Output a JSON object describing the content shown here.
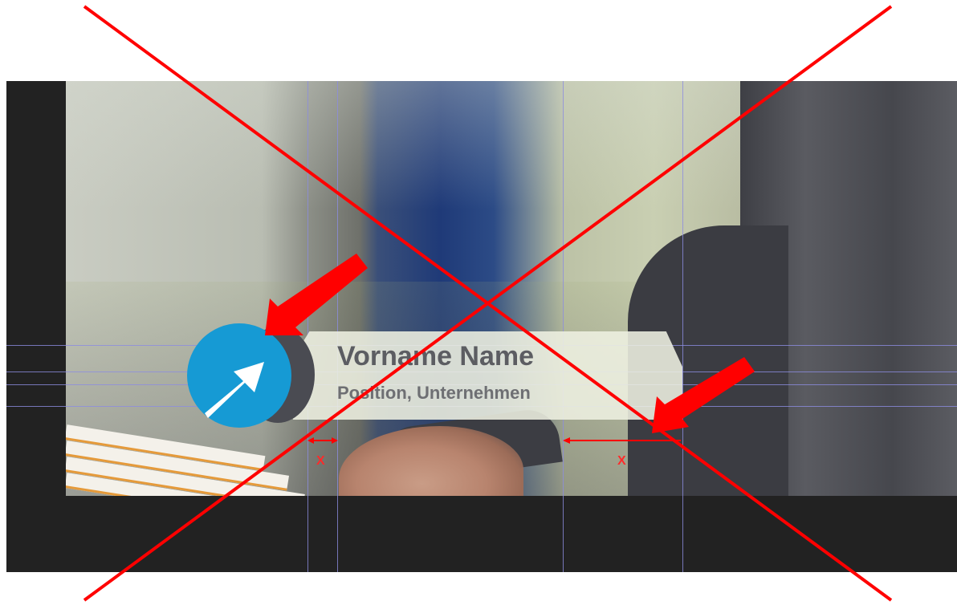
{
  "name_bar": {
    "title": "Vorname Name",
    "subtitle": "Position, Unternehmen"
  },
  "measure": {
    "label_left": "X",
    "label_right": "X"
  },
  "colors": {
    "brand_blue": "#169ad4",
    "annotation_red": "#ff0000",
    "guide": "#8c8ce0",
    "frame": "#222222"
  },
  "icons": {
    "logo": "arrow-up-right-icon",
    "pointer": "red-arrow-icon",
    "cross": "cross-out-icon"
  }
}
